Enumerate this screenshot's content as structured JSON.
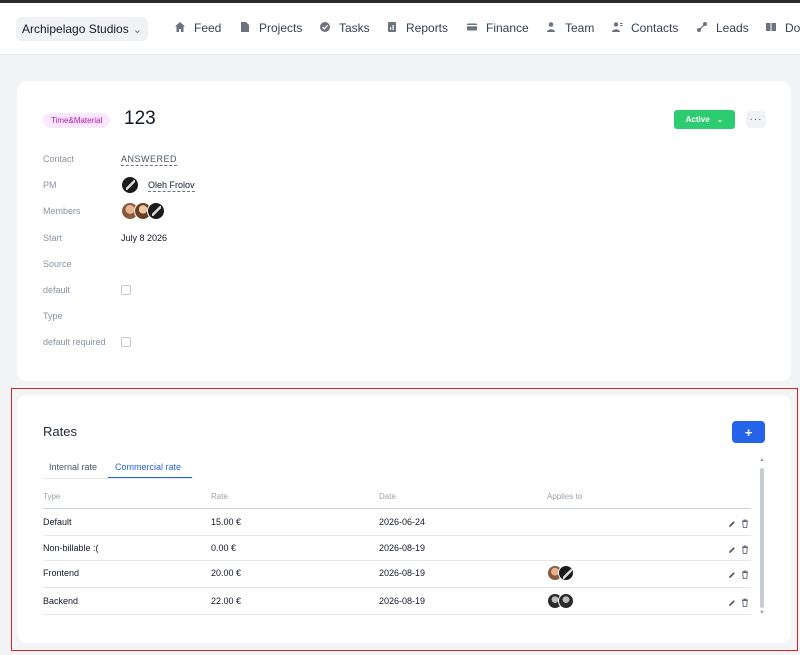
{
  "org": {
    "name": "Archipelago Studios"
  },
  "nav": [
    {
      "label": "Feed",
      "icon": "home-icon"
    },
    {
      "label": "Projects",
      "icon": "file-icon"
    },
    {
      "label": "Tasks",
      "icon": "check-circle-icon"
    },
    {
      "label": "Reports",
      "icon": "report-icon"
    },
    {
      "label": "Finance",
      "icon": "card-icon"
    },
    {
      "label": "Team",
      "icon": "person-icon"
    },
    {
      "label": "Contacts",
      "icon": "contacts-icon"
    },
    {
      "label": "Leads",
      "icon": "leads-icon"
    },
    {
      "label": "Doc",
      "icon": "doc-icon"
    }
  ],
  "project": {
    "type_tag": "Time&Material",
    "title": "123",
    "status": "Active",
    "more": "···",
    "fields": {
      "contact_label": "Contact",
      "contact_value": "ANSWERED",
      "pm_label": "PM",
      "pm_value": "Oleh Frolov",
      "members_label": "Members",
      "start_label": "Start",
      "start_value": "July 8 2026",
      "source_label": "Source",
      "default_label": "default",
      "type_label": "Type",
      "default_required_label": "default required"
    }
  },
  "rates": {
    "title": "Rates",
    "add_label": "+",
    "tabs": [
      "Internal rate",
      "Commercial rate"
    ],
    "active_tab": "Commercial rate",
    "columns": [
      "Type",
      "Rate",
      "Date",
      "Applies to"
    ],
    "rows": [
      {
        "type": "Default",
        "rate": "15.00 €",
        "date": "2026-06-24"
      },
      {
        "type": "Non-billable :(",
        "rate": "0.00 €",
        "date": "2026-08-19"
      },
      {
        "type": "Frontend",
        "rate": "20.00 €",
        "date": "2026-08-19"
      },
      {
        "type": "Backend",
        "rate": "22.00 €",
        "date": "2026-08-19"
      }
    ]
  },
  "colors": {
    "accent": "#2563eb",
    "status": "#2ecc71",
    "highlight": "#e02424",
    "tag_bg": "#fbe7ff",
    "tag_fg": "#b318b8"
  }
}
